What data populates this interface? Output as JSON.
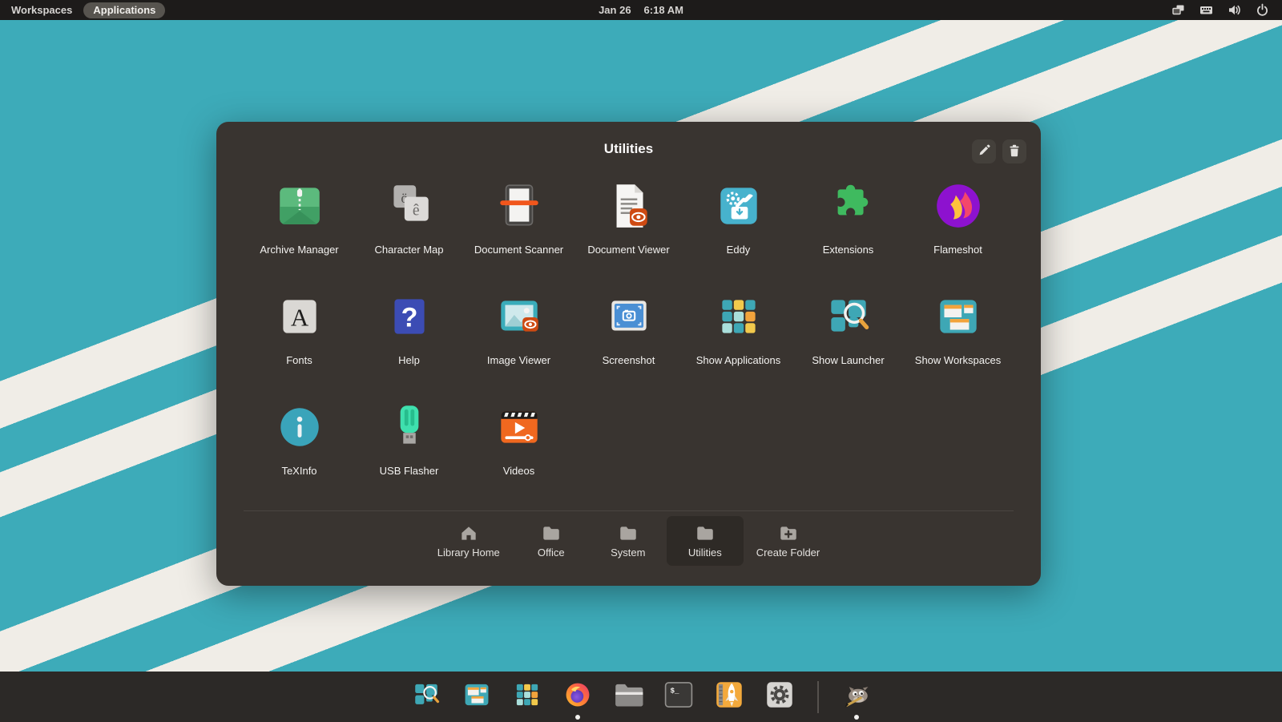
{
  "topbar": {
    "workspaces_label": "Workspaces",
    "applications_label": "Applications",
    "date": "Jan 26",
    "time": "6:18 AM",
    "tray_icons": [
      "windows-overlap-icon",
      "keyboard-icon",
      "volume-icon",
      "power-icon"
    ]
  },
  "folder_dialog": {
    "title": "Utilities",
    "actions": [
      {
        "name": "edit-folder",
        "icon": "pencil-icon"
      },
      {
        "name": "delete-folder",
        "icon": "trash-icon"
      }
    ],
    "apps": [
      {
        "label": "Archive Manager",
        "icon": "archive-manager-icon"
      },
      {
        "label": "Character Map",
        "icon": "character-map-icon"
      },
      {
        "label": "Document Scanner",
        "icon": "document-scanner-icon"
      },
      {
        "label": "Document Viewer",
        "icon": "document-viewer-icon"
      },
      {
        "label": "Eddy",
        "icon": "eddy-icon"
      },
      {
        "label": "Extensions",
        "icon": "extensions-icon"
      },
      {
        "label": "Flameshot",
        "icon": "flameshot-icon"
      },
      {
        "label": "Fonts",
        "icon": "fonts-icon"
      },
      {
        "label": "Help",
        "icon": "help-icon"
      },
      {
        "label": "Image Viewer",
        "icon": "image-viewer-icon"
      },
      {
        "label": "Screenshot",
        "icon": "screenshot-icon"
      },
      {
        "label": "Show Applications",
        "icon": "show-applications-icon"
      },
      {
        "label": "Show Launcher",
        "icon": "show-launcher-icon"
      },
      {
        "label": "Show Workspaces",
        "icon": "show-workspaces-icon"
      },
      {
        "label": "TeXInfo",
        "icon": "texinfo-icon"
      },
      {
        "label": "USB Flasher",
        "icon": "usb-flasher-icon"
      },
      {
        "label": "Videos",
        "icon": "videos-icon"
      }
    ],
    "categories": [
      {
        "label": "Library Home",
        "icon": "home-icon",
        "selected": false
      },
      {
        "label": "Office",
        "icon": "folder-icon",
        "selected": false
      },
      {
        "label": "System",
        "icon": "folder-icon",
        "selected": false
      },
      {
        "label": "Utilities",
        "icon": "folder-icon",
        "selected": true
      },
      {
        "label": "Create Folder",
        "icon": "new-folder-icon",
        "selected": false
      }
    ]
  },
  "icon_glyphs": {
    "character_map_back": "ö",
    "character_map_front": "ê",
    "fonts": "A",
    "help": "?",
    "terminal": "$_"
  },
  "dock": {
    "items": [
      {
        "name": "show-launcher",
        "running": false
      },
      {
        "name": "show-workspaces",
        "running": false
      },
      {
        "name": "show-applications",
        "running": false
      },
      {
        "name": "firefox",
        "running": true
      },
      {
        "name": "files",
        "running": false
      },
      {
        "name": "terminal",
        "running": false
      },
      {
        "name": "app-launcher",
        "running": false
      },
      {
        "name": "settings",
        "running": false
      },
      {
        "name": "gimp",
        "running": true
      }
    ]
  },
  "colors": {
    "wallpaper_teal": "#3dabb9",
    "wallpaper_stripe": "#f0ede7",
    "topbar_bg": "#1d1b1a",
    "dialog_bg": "#393430",
    "dock_bg": "#2c2927",
    "selected_tab_bg": "#2e2a26",
    "accent_orange": "#f2a33c"
  }
}
